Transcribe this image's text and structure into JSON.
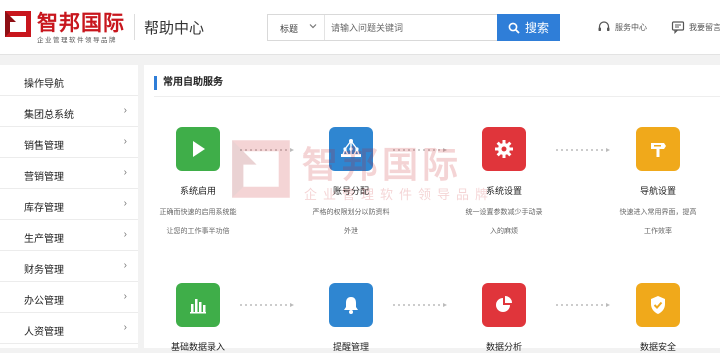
{
  "brand": {
    "title": "智邦国际",
    "subtitle": "企业管理软件领导品牌",
    "color": "#c8161d"
  },
  "header": {
    "page_title": "帮助中心",
    "search": {
      "type_label": "标题",
      "placeholder": "请输入问题关键词",
      "button_label": "搜索"
    },
    "service_label": "服务中心",
    "feedback_label": "我要留言"
  },
  "sidebar": {
    "items": [
      {
        "label": "操作导航",
        "has_arrow": false
      },
      {
        "label": "集团总系统",
        "has_arrow": true
      },
      {
        "label": "销售管理",
        "has_arrow": true
      },
      {
        "label": "营销管理",
        "has_arrow": true
      },
      {
        "label": "库存管理",
        "has_arrow": true
      },
      {
        "label": "生产管理",
        "has_arrow": true
      },
      {
        "label": "财务管理",
        "has_arrow": true
      },
      {
        "label": "办公管理",
        "has_arrow": true
      },
      {
        "label": "人资管理",
        "has_arrow": true
      }
    ]
  },
  "main": {
    "section_title": "常用自助服务",
    "services": [
      {
        "label": "系统启用",
        "desc": "正确而快速的启用系统能\n让您的工作事半功倍",
        "color": "#3fae49",
        "icon": "play-icon"
      },
      {
        "label": "账号分配",
        "desc": "严格的权限划分以防资料\n外泄",
        "color": "#2f86d1",
        "icon": "org-chart-icon"
      },
      {
        "label": "系统设置",
        "desc": "统一设置参数减少手动录\n入的麻烦",
        "color": "#e0353b",
        "icon": "gear-icon"
      },
      {
        "label": "导航设置",
        "desc": "快速进入常用界面，提高\n工作效率",
        "color": "#f0a91b",
        "icon": "signpost-icon"
      },
      {
        "label": "基础数据录入",
        "desc": "",
        "color": "#3fae49",
        "icon": "bar-chart-icon"
      },
      {
        "label": "提醒管理",
        "desc": "",
        "color": "#2f86d1",
        "icon": "bell-icon"
      },
      {
        "label": "数据分析",
        "desc": "",
        "color": "#e0353b",
        "icon": "pie-chart-icon"
      },
      {
        "label": "数据安全",
        "desc": "",
        "color": "#f0a91b",
        "icon": "shield-check-icon"
      }
    ]
  },
  "watermark": {
    "title": "智邦国际",
    "subtitle": "企业管理软件领导品牌"
  }
}
